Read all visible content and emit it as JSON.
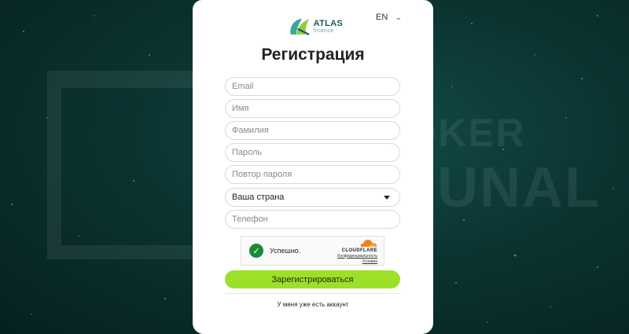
{
  "header": {
    "logo_primary": "ATLAS",
    "logo_secondary": "finance",
    "language": "EN"
  },
  "form": {
    "title": "Регистрация",
    "email_placeholder": "Email",
    "name_placeholder": "Имя",
    "surname_placeholder": "Фамилия",
    "password_placeholder": "Пароль",
    "password_repeat_placeholder": "Повтор пароля",
    "country_value": "Ваша страна",
    "phone_placeholder": "Телефон",
    "submit_label": "Зарегистрироваться",
    "login_link": "У меня уже есть аккаунт"
  },
  "captcha": {
    "status": "Успешно.",
    "brand": "CLOUDFLARE",
    "privacy_link": "Конфиденциальность",
    "terms_link": "Условия"
  },
  "watermark": {
    "line1": "BROKER",
    "line2": "TRIBUNAL"
  },
  "colors": {
    "accent_button": "#9ce02a",
    "background": "#0b3431",
    "success": "#1a8a3a",
    "cloudflare_orange": "#f38020"
  }
}
